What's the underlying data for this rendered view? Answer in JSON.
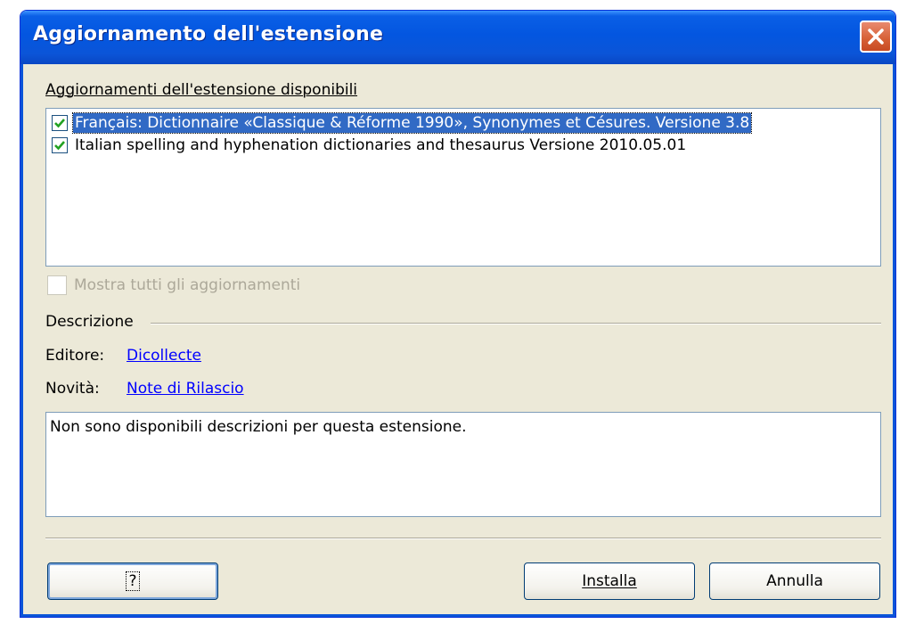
{
  "window": {
    "title": "Aggiornamento dell'estensione"
  },
  "updates": {
    "label": "Aggiornamenti dell'estensione disponibili",
    "items": [
      {
        "label": "Français: Dictionnaire «Classique & Réforme 1990», Synonymes et Césures. Versione 3.8",
        "checked": true,
        "selected": true
      },
      {
        "label": "Italian spelling and hyphenation dictionaries and thesaurus Versione 2010.05.01",
        "checked": true,
        "selected": false
      }
    ]
  },
  "show_all": {
    "label": "Mostra tutti gli aggiornamenti",
    "checked": false,
    "enabled": false
  },
  "description": {
    "heading": "Descrizione",
    "publisher_label": "Editore:",
    "publisher_link": "Dicollecte",
    "whatsnew_label": "Novità:",
    "whatsnew_link": "Note di Rilascio",
    "text": "Non sono disponibili descrizioni per questa estensione."
  },
  "buttons": {
    "help": "?",
    "install": "Installa",
    "cancel": "Annulla"
  },
  "colors": {
    "titlebar": "#0356e0",
    "close": "#d65f35",
    "selection": "#316ac5",
    "link": "#0000ff",
    "check": "#21a121"
  }
}
